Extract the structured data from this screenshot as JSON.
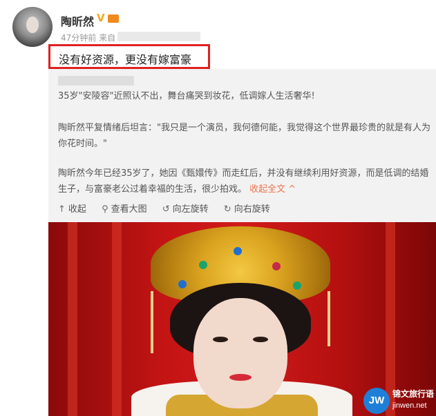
{
  "post": {
    "username": "陶昕然",
    "time": "47分钟前 来自",
    "content": "没有好资源，更没有嫁富豪"
  },
  "retweet": {
    "para1": "35岁\"安陵容\"近照认不出，舞台痛哭到妆花，低调嫁人生活奢华!",
    "para2": "陶昕然平复情绪后坦言：\"我只是一个演员，我何德何能，我觉得这个世界最珍贵的就是有人为你花时间。\"",
    "para3_main": "陶昕然今年已经35岁了，她因《甄嬛传》而走红后，并没有继续利用好资源，而是低调的结婚生子，与富豪老公过着幸福的生活，很少拍戏。",
    "para3_link": "收起全文 ^"
  },
  "actions": {
    "collapse": "收起",
    "view_large": "查看大图",
    "rotate_left": "向左旋转",
    "rotate_right": "向右旋转"
  },
  "icons": {
    "collapse": "arrow-up-icon",
    "view_large": "magnifier-icon",
    "rotate_left": "rotate-left-icon",
    "rotate_right": "rotate-right-icon",
    "verified": "verified-v-icon",
    "vip": "vip-crown-icon"
  },
  "watermark": {
    "logo": "JW",
    "name": "锦文旅行语",
    "url": "jinwen.net"
  },
  "colors": {
    "highlight_border": "#e02020",
    "link": "#eb7350",
    "verified": "#f5a623"
  }
}
